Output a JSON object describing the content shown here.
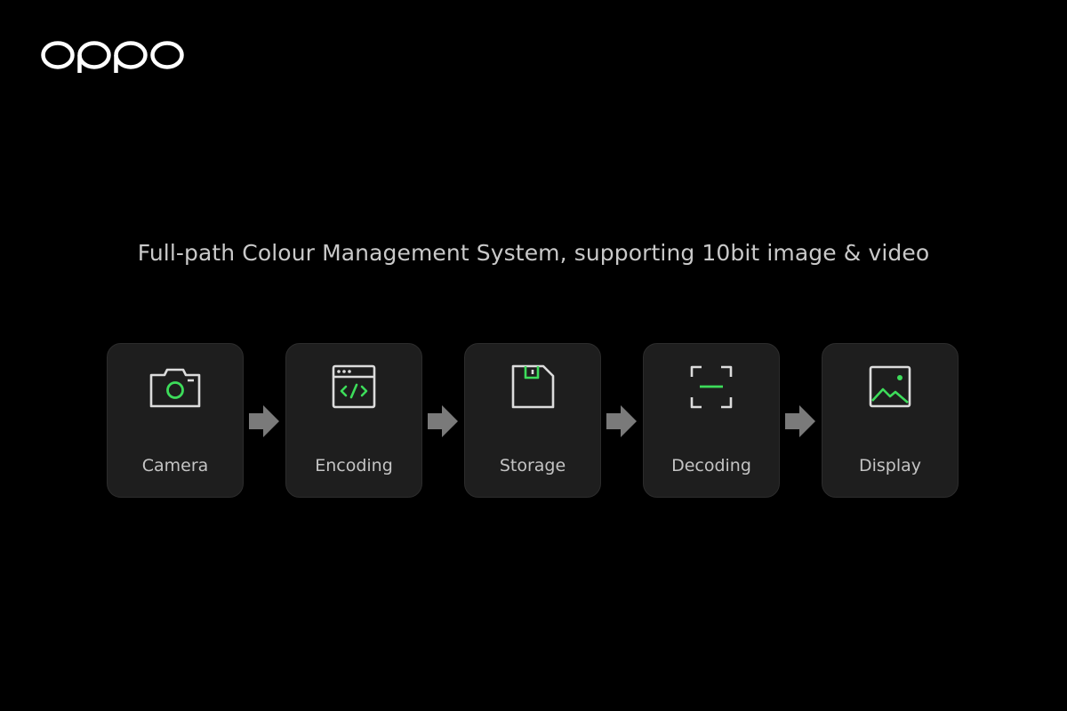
{
  "brand": {
    "logo_text": "oppo"
  },
  "headline": "Full-path Colour Management System, supporting 10bit image & video",
  "colors": {
    "background": "#000000",
    "card": "#1e1e1e",
    "icon_line": "#dcdcdc",
    "icon_accent": "#3ddc5a",
    "arrow": "#7a7a7a"
  },
  "pipeline": [
    {
      "label": "Camera",
      "icon": "camera-icon"
    },
    {
      "label": "Encoding",
      "icon": "code-window-icon"
    },
    {
      "label": "Storage",
      "icon": "floppy-disk-icon"
    },
    {
      "label": "Decoding",
      "icon": "scan-frame-icon"
    },
    {
      "label": "Display",
      "icon": "image-icon"
    }
  ]
}
